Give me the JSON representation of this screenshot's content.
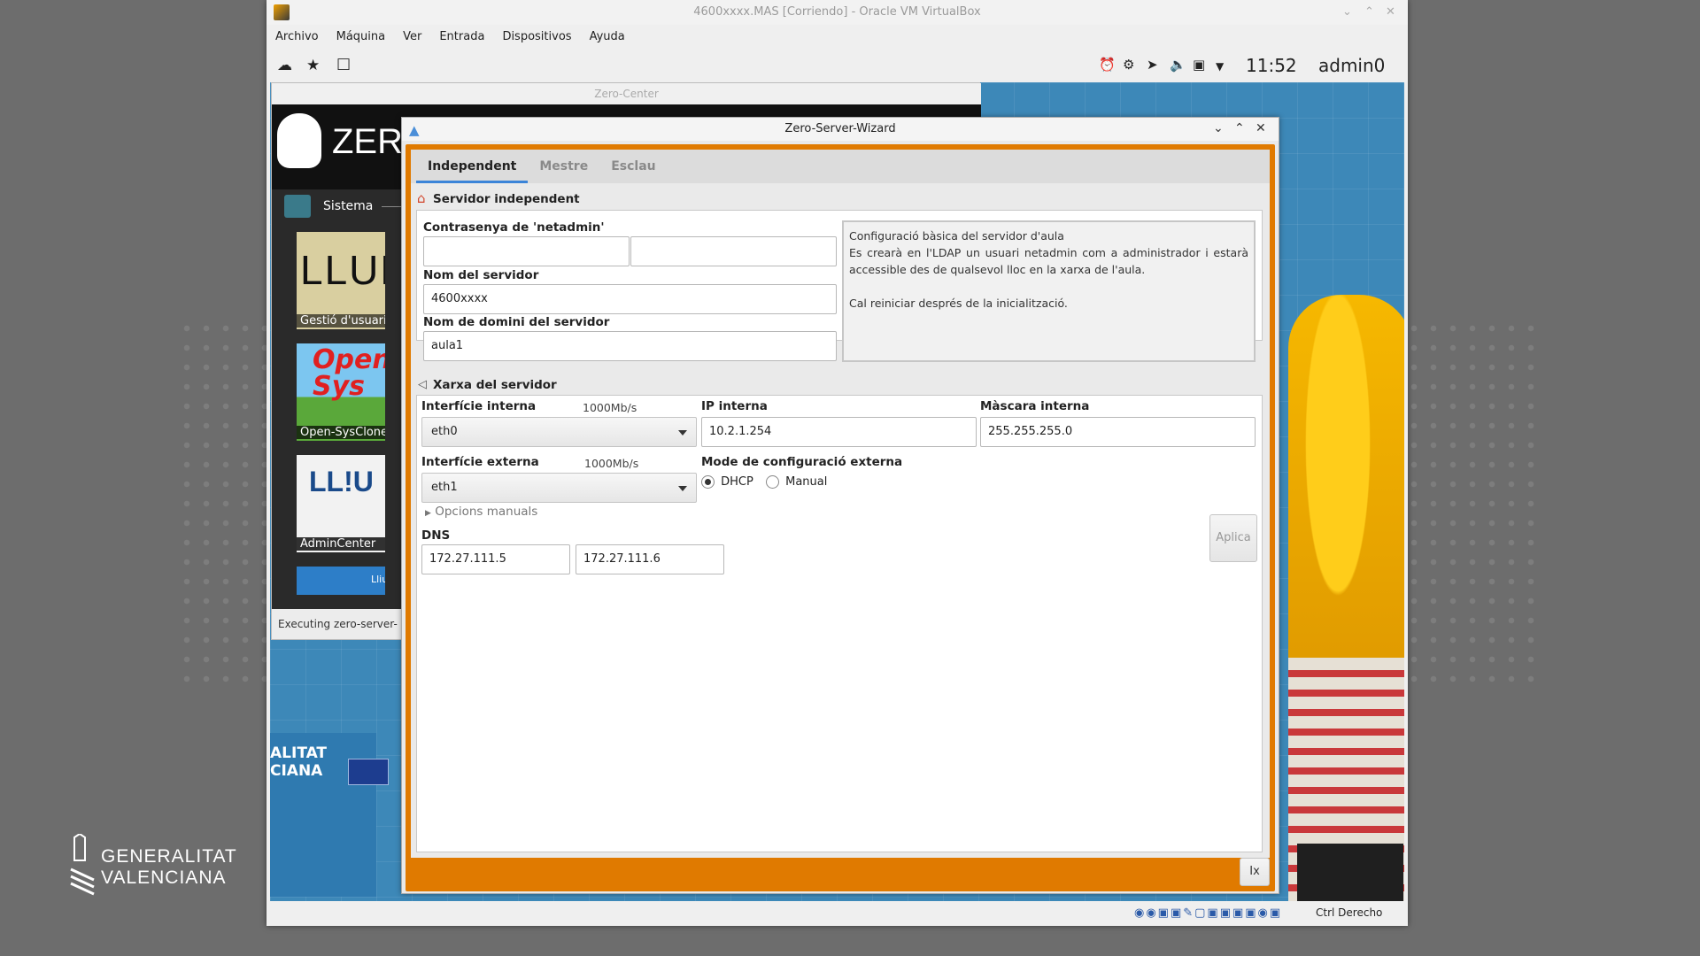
{
  "vbox": {
    "title": "4600xxxx.MAS [Corriendo] - Oracle VM VirtualBox",
    "menu": [
      "Archivo",
      "Máquina",
      "Ver",
      "Entrada",
      "Dispositivos",
      "Ayuda"
    ],
    "clock": "11:52",
    "user": "admin0",
    "host_key": "Ctrl Derecho"
  },
  "desktop": {
    "gva_line1": "GENERALITAT",
    "gva_line2": "VALENCIANA"
  },
  "guest_bg": {
    "gva_line1": "ALITAT",
    "gva_line2": "CIANA"
  },
  "zero_center": {
    "title": "Zero-Center",
    "logo_text": "ZER",
    "section": "Sistema",
    "tiles": [
      {
        "label": "Gestió d'usuaris",
        "art": "LLUM"
      },
      {
        "label": "Open-SysClone",
        "art": "Open Sys"
      },
      {
        "label": "AdminCenter",
        "art": "LL!U"
      },
      {
        "label": "",
        "art": "Lliur"
      }
    ],
    "status": "Executing zero-server-"
  },
  "wizard": {
    "title": "Zero-Server-Wizard",
    "tabs": [
      "Independent",
      "Mestre",
      "Esclau"
    ],
    "active_tab": "Independent",
    "server_group": {
      "title": "Servidor independent",
      "password_label": "Contrasenya de 'netadmin'",
      "password_value": "",
      "password_confirm_value": "",
      "server_name_label": "Nom del servidor",
      "server_name_value": "4600xxxx",
      "domain_label": "Nom de domini del servidor",
      "domain_value": "aula1",
      "info_line1": "Configuració bàsica del servidor d'aula",
      "info_line2": "Es crearà en l'LDAP un usuari netadmin com a administrador i estarà accessible des de qualsevol lloc en la xarxa de l'aula.",
      "info_line3": "Cal reiniciar després de la inicialització."
    },
    "network_group": {
      "title": "Xarxa del servidor",
      "internal_iface_label": "Interfície interna",
      "internal_speed": "1000Mb/s",
      "internal_iface_value": "eth0",
      "internal_ip_label": "IP interna",
      "internal_ip_value": "10.2.1.254",
      "internal_mask_label": "Màscara interna",
      "internal_mask_value": "255.255.255.0",
      "external_iface_label": "Interfície externa",
      "external_speed": "1000Mb/s",
      "external_iface_value": "eth1",
      "external_mode_label": "Mode de configuració externa",
      "mode_dhcp": "DHCP",
      "mode_manual": "Manual",
      "mode_selected": "DHCP",
      "manual_options": "Opcions manuals",
      "dns_label": "DNS",
      "dns1": "172.27.111.5",
      "dns2": "172.27.111.6",
      "apply_button": "Aplica"
    },
    "exit_button": "Ix"
  },
  "colors": {
    "accent": "#e07a00",
    "tab_underline": "#3b84d8",
    "guest_bg": "#3d88b8"
  }
}
